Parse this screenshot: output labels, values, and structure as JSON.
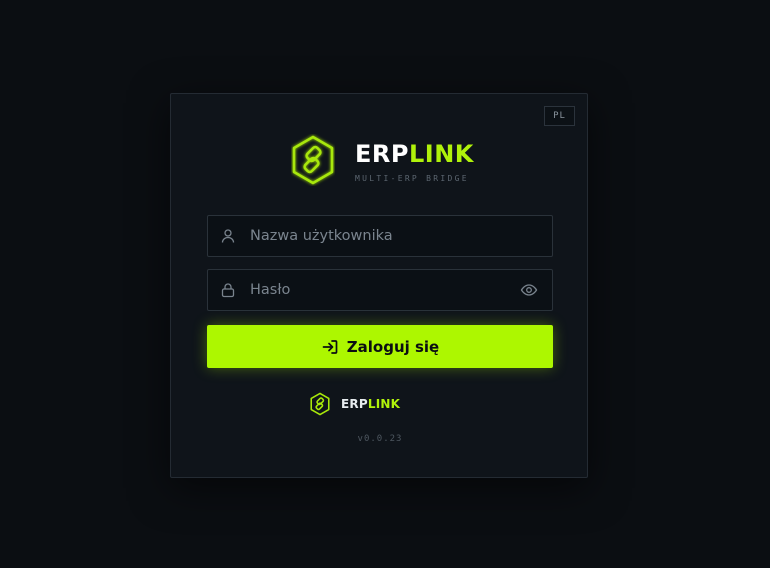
{
  "language_toggle": {
    "label": "PL"
  },
  "brand": {
    "name_part1": "ERP",
    "name_part2": "LINK",
    "tagline": "MULTI-ERP BRIDGE",
    "logo_icon": "hexagon-link-logo-icon"
  },
  "form": {
    "username": {
      "placeholder": "Nazwa użytkownika",
      "value": "",
      "icon": "user-icon"
    },
    "password": {
      "placeholder": "Hasło",
      "value": "",
      "icon": "lock-icon",
      "toggle_icon": "eye-icon"
    },
    "submit": {
      "label": "Zaloguj się",
      "icon": "login-arrow-icon"
    }
  },
  "footer": {
    "name_part1": "ERP",
    "name_part2": "LINK",
    "version": "v0.0.23"
  },
  "colors": {
    "background": "#0b0e12",
    "card": "#0f141a",
    "accent": "#b0f20b",
    "button": "#adf700"
  }
}
